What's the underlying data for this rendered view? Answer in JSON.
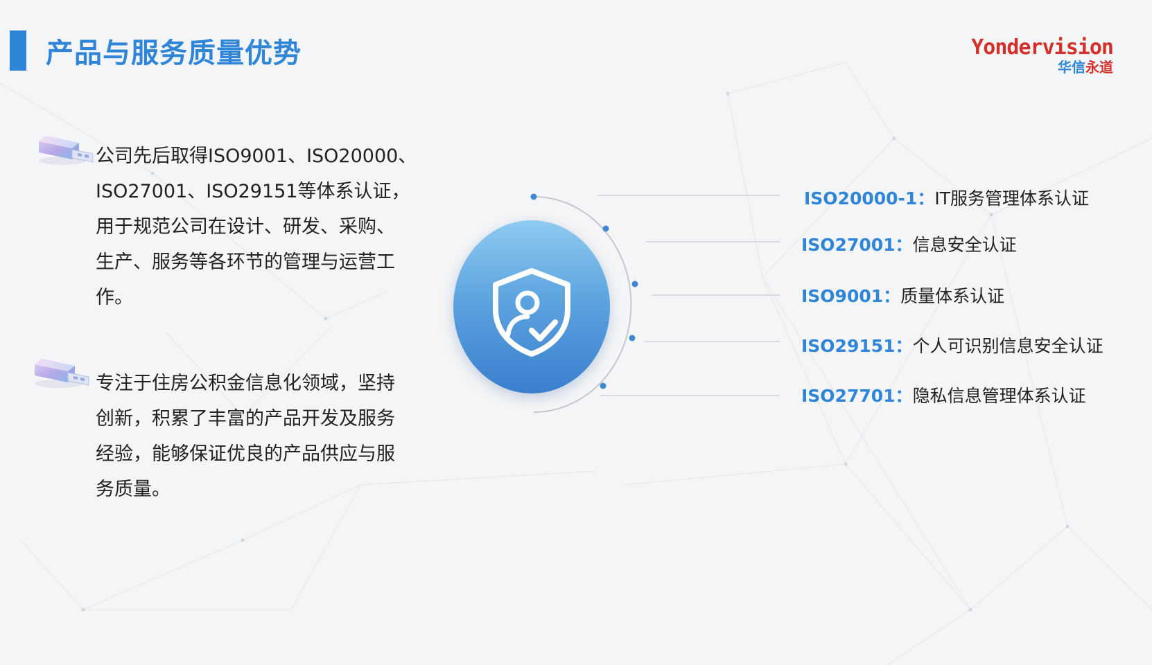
{
  "header": {
    "title": "产品与服务质量优势"
  },
  "logo": {
    "en": "Yondervision",
    "cn_a": "华信",
    "cn_b": "永道"
  },
  "paragraphs": [
    {
      "icon": "usb-drive-icon",
      "lines": [
        "公司先后取得ISO9001、ISO20000、",
        "ISO27001、ISO29151等体系认证，",
        "用于规范公司在设计、研发、采购、",
        "生产、服务等各环节的管理与运营工",
        "作。"
      ]
    },
    {
      "icon": "usb-drive-icon",
      "lines": [
        "专注于住房公积金信息化领域，坚持",
        "创新，积累了丰富的产品开发及服务",
        "经验，能够保证优良的产品供应与服",
        "务质量。"
      ]
    }
  ],
  "center": {
    "icon": "shield-user-check-icon"
  },
  "certifications": [
    {
      "code": "ISO20000-1",
      "sep": "：",
      "desc": "IT服务管理体系认证"
    },
    {
      "code": "ISO27001",
      "sep": "：",
      "desc": "信息安全认证"
    },
    {
      "code": "ISO9001",
      "sep": "：",
      "desc": "质量体系认证"
    },
    {
      "code": "ISO29151",
      "sep": "：",
      "desc": "个人可识别信息安全认证"
    },
    {
      "code": "ISO27701",
      "sep": "：",
      "desc": "隐私信息管理体系认证"
    }
  ],
  "colors": {
    "accent": "#2f86d9",
    "brand_red": "#d4302a",
    "background": "#f4f5f6"
  }
}
